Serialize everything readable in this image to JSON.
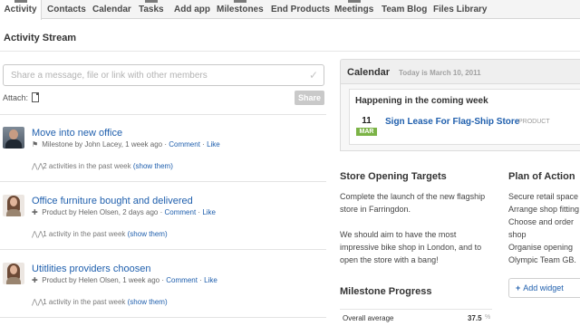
{
  "nav": {
    "tabs": [
      {
        "label": "Activity",
        "active": true
      },
      {
        "label": "Contacts"
      },
      {
        "label": "Calendar"
      },
      {
        "label": "Tasks"
      },
      {
        "label": "Add app"
      },
      {
        "label": "Milestones"
      },
      {
        "label": "End Products"
      },
      {
        "label": "Meetings"
      },
      {
        "label": "Team Blog"
      },
      {
        "label": "Files Library"
      }
    ]
  },
  "page": {
    "title": "Activity Stream"
  },
  "share": {
    "placeholder": "Share a message, file or link with other members",
    "attach_label": "Attach:",
    "button_label": "Share"
  },
  "stream": {
    "items": [
      {
        "title": "Move into new office",
        "type": "Milestone",
        "by": "by",
        "author": "John Lacey",
        "time": ", 1 week ago",
        "comment": "Comment",
        "like": "Like",
        "activity_text": "2 activities in the past week",
        "show": "(show them)",
        "avatar_icon": "person-avatar-icon",
        "type_icon": "flag-icon"
      },
      {
        "title": "Office furniture bought and delivered",
        "type": "Product",
        "by": "by",
        "author": "Helen Olsen",
        "time": ", 2 days ago",
        "comment": "Comment",
        "like": "Like",
        "activity_text": "1 activity in the past week",
        "show": "(show them)",
        "avatar_icon": "person-avatar-icon",
        "type_icon": "puzzle-icon"
      },
      {
        "title": "Utitlities providers choosen",
        "type": "Product",
        "by": "by",
        "author": "Helen Olsen",
        "time": ", 1 week ago",
        "comment": "Comment",
        "like": "Like",
        "activity_text": "1 activity in the past week",
        "show": "(show them)",
        "avatar_icon": "person-avatar-icon",
        "type_icon": "puzzle-icon"
      }
    ]
  },
  "calendar": {
    "title": "Calendar",
    "today": "Today is March 10, 2011",
    "section": "Happening in the coming week",
    "event": {
      "day": "11",
      "month": "MAR",
      "title": "Sign Lease For Flag-Ship Store",
      "type": "PRODUCT"
    }
  },
  "targets": {
    "title": "Store Opening Targets",
    "para1": "Complete the launch of the new flagship store in Farringdon.",
    "para2": "We should aim to have the most impressive bike shop in London, and to open the store with a bang!"
  },
  "plan": {
    "title": "Plan of Action",
    "lines": [
      "Secure retail space",
      "Arrange shop fitting",
      "Choose and order",
      "shop",
      "Organise opening",
      "Olympic Team GB."
    ]
  },
  "widget": {
    "add_label": "Add widget"
  },
  "milestones": {
    "title": "Milestone Progress",
    "overall_label": "Overall average",
    "overall_value": "37.5",
    "overall_unit": "%"
  },
  "colors": {
    "link": "#1f5fad",
    "accent_green": "#7bb346",
    "nav_bg": "#f4f4f4"
  }
}
